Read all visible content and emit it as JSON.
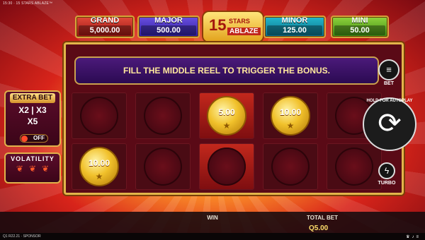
{
  "window_title": "15:30 · 15 STARS ABLAZE™",
  "jackpots": {
    "grand": {
      "label": "GRAND",
      "value": "5,000.00"
    },
    "major": {
      "label": "MAJOR",
      "value": "500.00"
    },
    "minor": {
      "label": "MINOR",
      "value": "125.00"
    },
    "mini": {
      "label": "MINI",
      "value": "50.00"
    }
  },
  "logo": {
    "number": "15",
    "line1": "STARS",
    "line2": "ABLAZE"
  },
  "banner_text": "FILL THE MIDDLE REEL TO TRIGGER THE BONUS.",
  "extra_bet": {
    "title": "EXTRA BET",
    "multipliers_line1": "X2 | X3",
    "multipliers_line2": "X5",
    "toggle_state": "OFF"
  },
  "volatility": {
    "title": "VOLATILITY",
    "level": 3,
    "max": 3
  },
  "coins": {
    "r1c3": "5.00",
    "r1c4": "10.00",
    "r2c1": "10.00"
  },
  "controls": {
    "bet_label": "BET",
    "autoplay_label": "HOLD FOR AUTOPLAY",
    "turbo_label": "TURBO"
  },
  "bottom_bar": {
    "win_label": "WIN",
    "total_bet_label": "TOTAL BET",
    "total_bet_value": "Q5.00"
  },
  "footer": {
    "info": "Q1 R22.21 · SPONSOR"
  },
  "colors": {
    "accent": "#e2b54a",
    "coin": "#f1c12b",
    "banner": "#2b0a52"
  }
}
